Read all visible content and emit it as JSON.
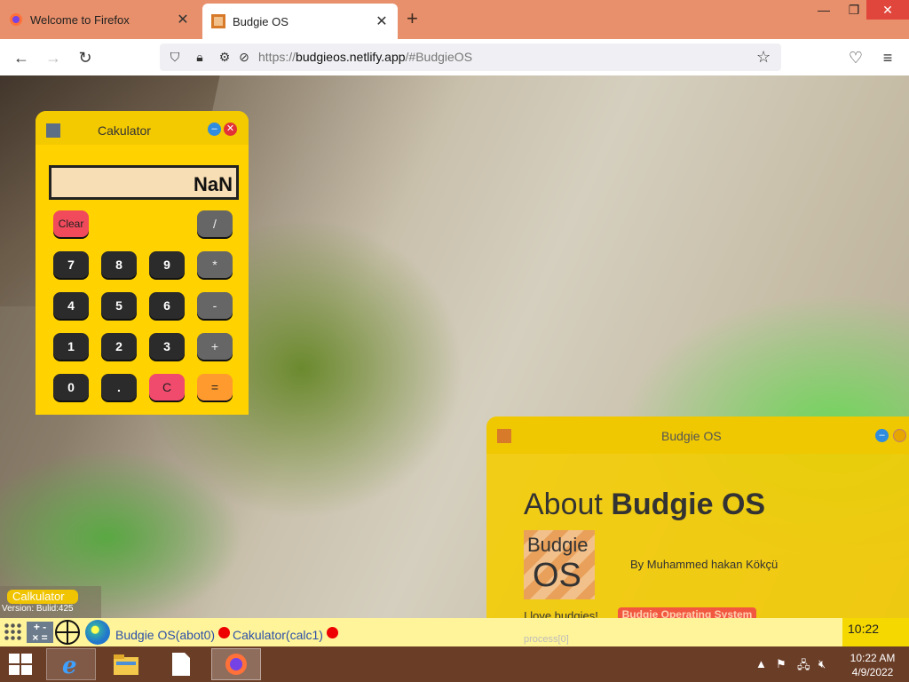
{
  "browser": {
    "tabs": [
      {
        "label": "Welcome to Firefox",
        "active": false
      },
      {
        "label": "Budgie OS",
        "active": true
      }
    ],
    "new_tab": "+",
    "url_scheme": "https://",
    "url_host": "budgieos.netlify.app",
    "url_path": "/#BudgieOS"
  },
  "calculator": {
    "title": "Cakulator",
    "display": "NaN",
    "keys": {
      "clear": "Clear",
      "divide": "/",
      "k7": "7",
      "k8": "8",
      "k9": "9",
      "multiply": "*",
      "k4": "4",
      "k5": "5",
      "k6": "6",
      "minus": "-",
      "k1": "1",
      "k2": "2",
      "k3": "3",
      "plus": "+",
      "k0": "0",
      "dot": ".",
      "c": "C",
      "equals": "="
    }
  },
  "about": {
    "title": "Budgie OS",
    "heading_prefix": "About",
    "heading_bold": "Budgie OS",
    "logo_line1": "Budgie",
    "logo_line2": "OS",
    "author": "By Muhammed hakan Kökçü",
    "love": "I love budgies!",
    "tag": "Budgie Operating System"
  },
  "version_widget": {
    "app": "Calkulator",
    "text": "Version: Bulid:425"
  },
  "os_taskbar": {
    "items": [
      {
        "label": "Budgie OS(abot0)"
      },
      {
        "label": "Cakulator(calc1)"
      }
    ],
    "clock": "10:22",
    "hidden_text": "process[0]"
  },
  "windows_taskbar": {
    "time": "10:22 AM",
    "date": "4/9/2022"
  },
  "colors": {
    "calc_bg": "#ffd200",
    "about_bg": "#f6cd00",
    "os_taskbar": "#fff49a",
    "win_taskbar": "#6a3d27",
    "tabstrip": "#e8906b"
  }
}
